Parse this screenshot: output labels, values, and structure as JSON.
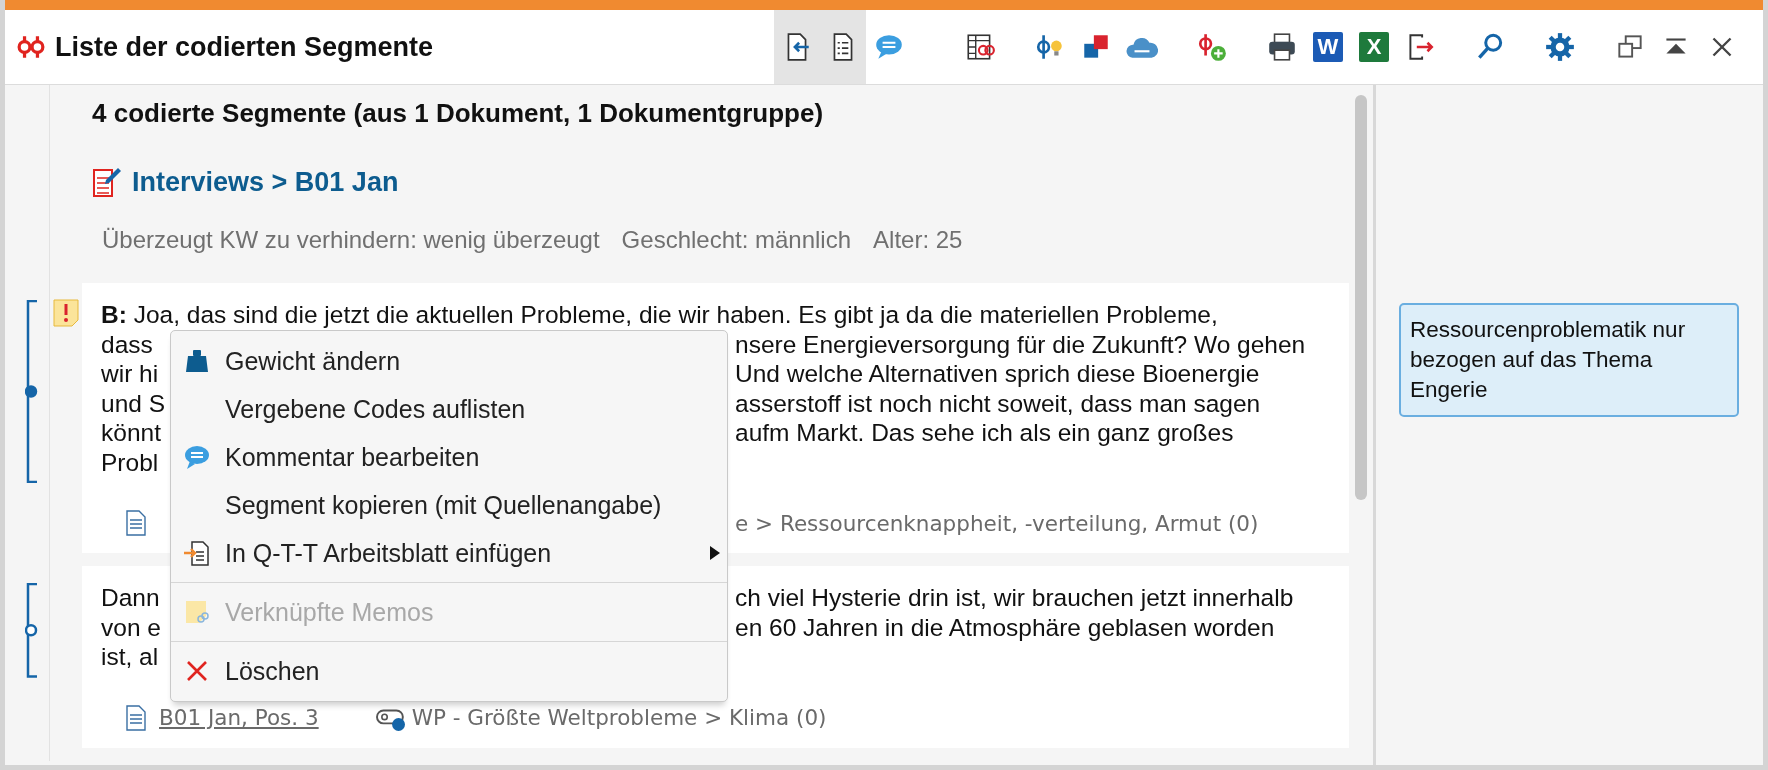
{
  "window": {
    "title": "Liste der codierten Segmente"
  },
  "toolbar_groups": [
    [
      {
        "kind": "import-doc",
        "selected": true
      },
      {
        "kind": "list-doc",
        "selected": true
      },
      {
        "kind": "comment",
        "selected": false
      }
    ],
    [
      {
        "kind": "table-code",
        "selected": false
      }
    ],
    [
      {
        "kind": "code-bulb",
        "selected": false
      },
      {
        "kind": "squares",
        "selected": false
      },
      {
        "kind": "cloud",
        "selected": false
      }
    ],
    [
      {
        "kind": "code-add",
        "selected": false
      }
    ],
    [
      {
        "kind": "print",
        "selected": false
      },
      {
        "kind": "word",
        "selected": false,
        "label": "W"
      },
      {
        "kind": "excel",
        "selected": false,
        "label": "X"
      },
      {
        "kind": "export",
        "selected": false
      }
    ],
    [
      {
        "kind": "search",
        "selected": false
      }
    ],
    [
      {
        "kind": "settings",
        "selected": false
      }
    ],
    [
      {
        "kind": "restore",
        "selected": false
      },
      {
        "kind": "collapse",
        "selected": false
      },
      {
        "kind": "close",
        "selected": false
      }
    ]
  ],
  "summary": "4 codierte Segmente (aus 1 Dokument, 1 Dokumentgruppe)",
  "document": {
    "path": "Interviews > B01 Jan",
    "attributes": [
      "Überzeugt KW zu verhindern: wenig überzeugt",
      "Geschlecht: männlich",
      "Alter: 25"
    ]
  },
  "segments": [
    {
      "has_memo": true,
      "marker_filled": true,
      "lines": [
        {
          "left": "**B:** Joa, das sind die jetzt die aktuellen Probleme, die wir haben. Es gibt ja da die materiellen Probleme,"
        },
        {
          "left": "dass",
          "right": "nsere Energieversorgung für die Zukunft? Wo gehen"
        },
        {
          "left": "wir hi",
          "right": "Und welche Alternativen sprich diese Bioenergie"
        },
        {
          "left": "und S",
          "right": "asserstoff ist noch nicht soweit, dass man sagen"
        },
        {
          "left": "könnt",
          "right": "aufm Markt. Das sehe ich als ein ganz großes"
        },
        {
          "left": "Probl"
        }
      ],
      "code": "e > Ressourcenknappheit, -verteilung, Armut (0)",
      "code_icon": false
    },
    {
      "has_memo": false,
      "marker_filled": false,
      "lines": [
        {
          "left": "Dann",
          "right": "ch viel Hysterie drin ist, wir brauchen jetzt innerhalb"
        },
        {
          "left": "von e",
          "right": "en 60 Jahren in die Atmosphäre geblasen worden"
        },
        {
          "left": "ist, al"
        }
      ],
      "source": "B01 Jan, Pos. 3",
      "code": "WP - Größte Weltprobleme > Klima (0)",
      "code_icon": true
    }
  ],
  "context_menu": [
    {
      "kind": "weight",
      "label": "Gewicht ändern",
      "disabled": false,
      "submenu": false
    },
    {
      "kind": "plain",
      "label": "Vergebene Codes auflisten",
      "disabled": false,
      "submenu": false
    },
    {
      "kind": "comment",
      "label": "Kommentar bearbeiten",
      "disabled": false,
      "submenu": false
    },
    {
      "kind": "plain",
      "label": "Segment kopieren (mit Quellenangabe)",
      "disabled": false,
      "submenu": false
    },
    {
      "kind": "insert",
      "label": "In Q-T-T Arbeitsblatt einfügen",
      "disabled": false,
      "submenu": true
    },
    {
      "kind": "separator"
    },
    {
      "kind": "memo",
      "label": "Verknüpfte Memos",
      "disabled": true,
      "submenu": false
    },
    {
      "kind": "separator"
    },
    {
      "kind": "delete",
      "label": "Löschen",
      "disabled": false,
      "submenu": false
    }
  ],
  "memo_panel": {
    "note": "Ressourcenproblematik nur bezogen auf das Thema Engerie"
  }
}
